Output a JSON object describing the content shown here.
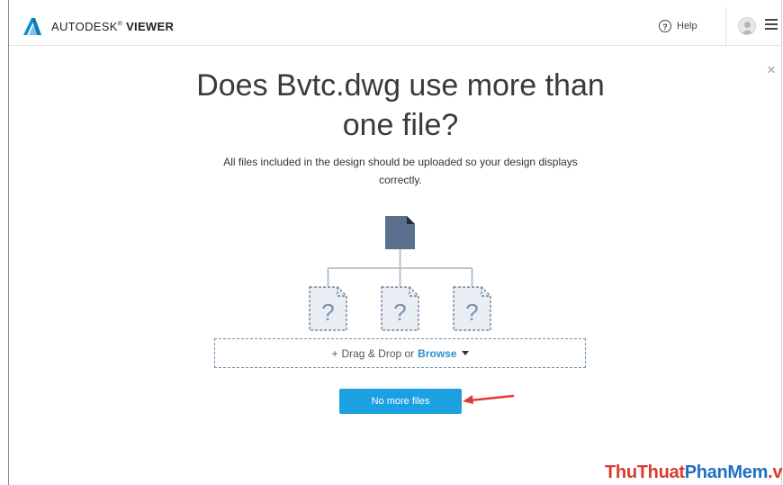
{
  "app": {
    "brand_name": "AUTODESK",
    "brand_mark": "®",
    "brand_product": "VIEWER"
  },
  "header": {
    "help_icon_glyph": "?",
    "help_label": "Help"
  },
  "dialog": {
    "close_glyph": "×",
    "title": "Does Bvtc.dwg use more than one file?",
    "subtitle": "All files included in the design should be uploaded so your design displays correctly.",
    "placeholder_glyph": "?",
    "dropzone": {
      "plus": "+",
      "text": "Drag & Drop or",
      "browse": "Browse"
    },
    "primary_button": "No more files"
  },
  "watermark": {
    "part1": "ThuThuat",
    "part2": "PhanMem",
    "part3": ".vn"
  },
  "colors": {
    "accent": "#1ba1e2",
    "browse_link": "#2a8fd2",
    "main_file": "#5a6f8c",
    "placeholder_file": "#e9eef4",
    "connector": "#a7b4c2",
    "annotation_arrow": "#e53935",
    "watermark_red": "#d83b2a",
    "watermark_blue": "#1f6fc5"
  }
}
